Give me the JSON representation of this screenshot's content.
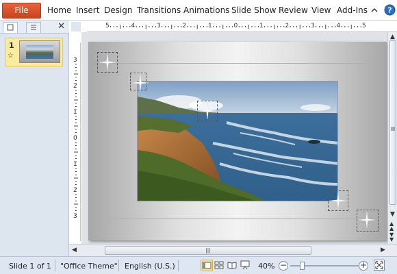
{
  "ribbon": {
    "file_label": "File",
    "tabs": [
      "Home",
      "Insert",
      "Design",
      "Transitions",
      "Animations",
      "Slide Show",
      "Review",
      "View",
      "Add-Ins"
    ],
    "minimize_icon": "chevron-up-icon",
    "help_icon": "help-icon"
  },
  "slides_pane": {
    "tabs": [
      "slides-tab-icon",
      "outline-tab-icon"
    ],
    "close_label": "✕",
    "thumbnails": [
      {
        "number": "1",
        "animation_icon": "☆"
      }
    ]
  },
  "ruler": {
    "horizontal_labels": [
      "5",
      "4",
      "3",
      "2",
      "1",
      "0",
      "1",
      "2",
      "3",
      "4",
      "5"
    ],
    "vertical_labels": [
      "3",
      "2",
      "1",
      "0",
      "1",
      "2",
      "3"
    ]
  },
  "slide": {
    "photo_subject": "coastal cliffs and ocean",
    "sparkles": 5
  },
  "scroll": {
    "h_thumb_grip": "|||"
  },
  "status": {
    "slide_info": "Slide 1 of 1",
    "theme": "\"Office Theme\"",
    "language": "English (U.S.)",
    "zoom_label": "40%",
    "zoom_level_percent": 40,
    "zoom_out": "−",
    "zoom_in": "+"
  },
  "colors": {
    "file_tab": "#d4502a",
    "help_icon": "#2a6ebf",
    "pane_bg": "#dde5ef",
    "selected_thumb": "#fbeb9f",
    "status_bg": "#dde6f1"
  }
}
